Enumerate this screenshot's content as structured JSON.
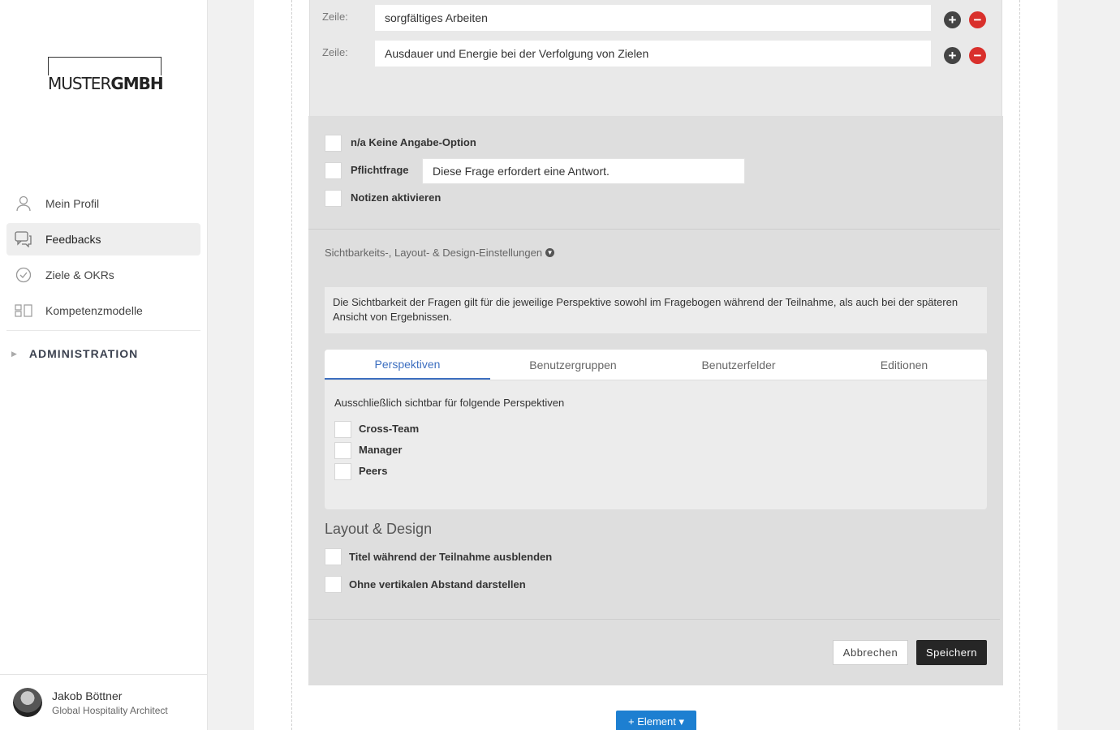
{
  "logo": {
    "part1": "MUSTER",
    "part2": "GMBH"
  },
  "nav": {
    "items": [
      {
        "label": "Mein Profil",
        "icon": "user-icon"
      },
      {
        "label": "Feedbacks",
        "icon": "chat-icon",
        "active": true
      },
      {
        "label": "Ziele & OKRs",
        "icon": "check-circle-icon"
      },
      {
        "label": "Kompetenzmodelle",
        "icon": "grid-icon"
      }
    ],
    "admin": "ADMINISTRATION"
  },
  "user": {
    "name": "Jakob Böttner",
    "role": "Global Hospitality Architect"
  },
  "rows": [
    {
      "label": "Zeile:",
      "value": "sorgfältiges Arbeiten"
    },
    {
      "label": "Zeile:",
      "value": "Ausdauer und Energie bei der Verfolgung von Zielen"
    }
  ],
  "options": {
    "na": "n/a Keine Angabe-Option",
    "required": "Pflichtfrage",
    "required_text": "Diese Frage erfordert eine Antwort.",
    "notes": "Notizen aktivieren"
  },
  "visibility": {
    "toggle": "Sichtbarkeits-, Layout- & Design-Einstellungen",
    "info": "Die Sichtbarkeit der Fragen gilt für die jeweilige Perspektive sowohl im Fragebogen während der Teilnahme, als auch bei der späteren Ansicht von Ergebnissen.",
    "tabs": [
      "Perspektiven",
      "Benutzergruppen",
      "Benutzerfelder",
      "Editionen"
    ],
    "desc": "Ausschließlich sichtbar für folgende Perspektiven",
    "perspectives": [
      "Cross-Team",
      "Manager",
      "Peers"
    ]
  },
  "layout": {
    "title": "Layout & Design",
    "hide_title": "Titel während der Teilnahme ausblenden",
    "no_spacing": "Ohne vertikalen Abstand darstellen"
  },
  "buttons": {
    "cancel": "Abbrechen",
    "save": "Speichern",
    "add_element": "+ Element ▾"
  },
  "colors": {
    "accent": "#3d6fc0",
    "primary_button": "#1d7fd1",
    "remove": "#d9302c",
    "save": "#262626"
  }
}
